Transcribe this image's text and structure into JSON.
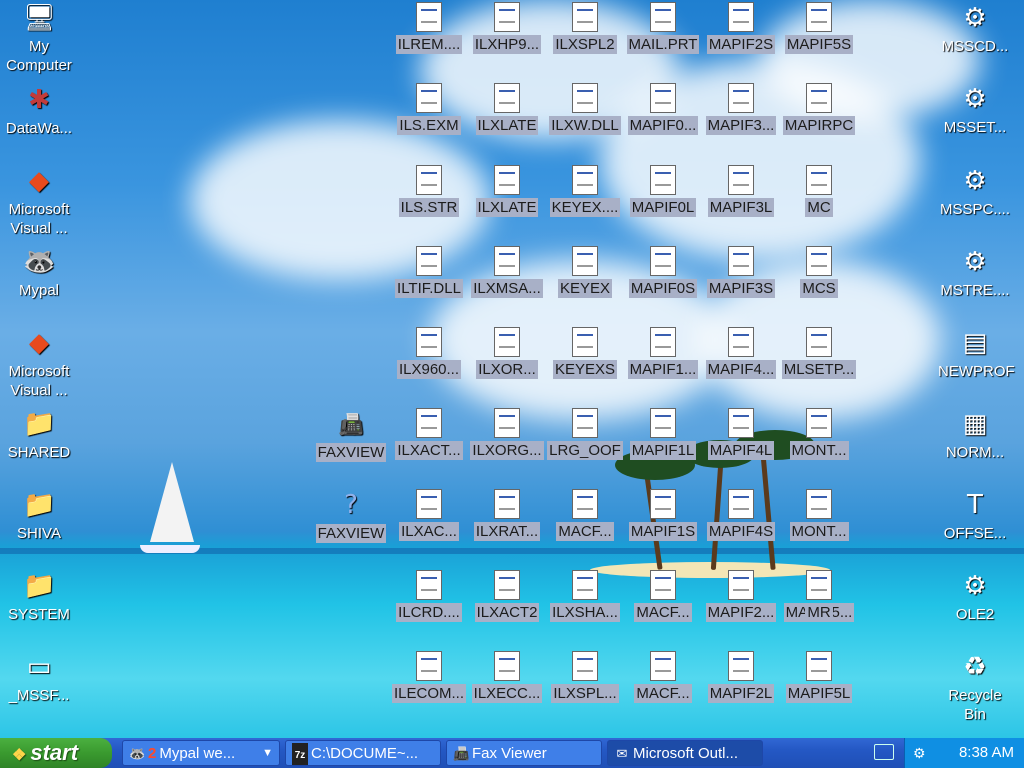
{
  "desktop": {
    "left_icons": [
      {
        "label": "My Computer",
        "glyph": "🖥"
      },
      {
        "label": "DataWa...",
        "glyph": "✱"
      },
      {
        "label": "Microsoft Visual ...",
        "glyph": "◆"
      },
      {
        "label": "Mypal",
        "glyph": "🦝"
      },
      {
        "label": "Microsoft Visual ...",
        "glyph": "◆"
      },
      {
        "label": "SHARED",
        "glyph": "📁"
      },
      {
        "label": "SHIVA",
        "glyph": "📁"
      },
      {
        "label": "SYSTEM",
        "glyph": "📁"
      },
      {
        "label": "_MSSF...",
        "glyph": "▭"
      }
    ],
    "grid_icons": {
      "col1": [
        "ILREM....",
        "ILS.EXM",
        "ILS.STR",
        "ILTIF.DLL",
        "ILX960...",
        "ILXACT...",
        "ILXAC...",
        "ILCRD....",
        "ILECOM..."
      ],
      "col2": [
        "ILXHP9...",
        "ILXLATE",
        "ILXLATE",
        "ILXMSA...",
        "ILXOR...",
        "ILXORG...",
        "ILXRAT...",
        "ILXACT2",
        "ILXECC..."
      ],
      "col3": [
        "ILXSPL2",
        "ILXW.DLL",
        "KEYEX....",
        "KEYEX",
        "KEYEXS",
        "LRG_OOF",
        "MACF...",
        "ILXSHA...",
        "ILXSPL..."
      ],
      "col4": [
        "MAIL.PRT",
        "MAPIF0...",
        "MAPIF0L",
        "MAPIF0S",
        "MAPIF1...",
        "MAPIF1L",
        "MAPIF1S",
        "MACF...",
        "MACF..."
      ],
      "col5": [
        "MAPIF2S",
        "MAPIF3...",
        "MAPIF3L",
        "MAPIF3S",
        "MAPIF4...",
        "MAPIF4L",
        "MAPIF4S",
        "MAPIF2...",
        "MAPIF2L"
      ],
      "col6": [
        "MAPIF5S",
        "MAPIRPC",
        "MC",
        "MCS",
        "MLSETP...",
        "MONT...",
        "MONT...",
        "MAPIF5...",
        "MAPIF5L"
      ],
      "col7": [
        "",
        "",
        "",
        "",
        "",
        "",
        "",
        "MR",
        ""
      ],
      "faxview": [
        "FAXVIEW",
        "FAXVIEW"
      ]
    },
    "right_icons": [
      {
        "label": "MSSCD...",
        "glyph": "⚙"
      },
      {
        "label": "MSSET...",
        "glyph": "⚙"
      },
      {
        "label": "MSSPC....",
        "glyph": "⚙"
      },
      {
        "label": "MSTRE....",
        "glyph": "⚙"
      },
      {
        "label": "NEWPROF",
        "glyph": "▤"
      },
      {
        "label": "NORM...",
        "glyph": "▦"
      },
      {
        "label": "OFFSE...",
        "glyph": "T"
      },
      {
        "label": "OLE2",
        "glyph": "⚙"
      },
      {
        "label": "Recycle Bin",
        "glyph": "♻"
      }
    ]
  },
  "taskbar": {
    "start_label": "start",
    "buttons": [
      {
        "icon": "🦝",
        "badge": "2",
        "label": "Mypal we...",
        "caret": "▼"
      },
      {
        "icon": "7z",
        "label": "C:\\DOCUME~..."
      },
      {
        "icon": "📠",
        "label": "Fax Viewer"
      },
      {
        "icon": "✉",
        "label": "Microsoft Outl..."
      }
    ],
    "tray": {
      "time": "8:38 AM",
      "icon": "⚙"
    }
  }
}
